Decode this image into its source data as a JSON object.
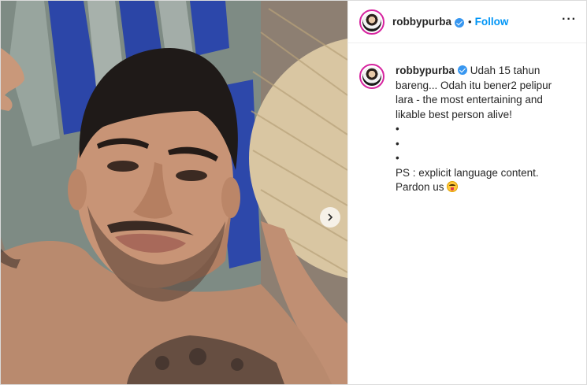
{
  "post": {
    "author": {
      "username": "robbypurba",
      "verified": true
    },
    "header": {
      "separator": "•",
      "follow_label": "Follow",
      "more_label": "···"
    },
    "caption": {
      "lines": [
        "Udah 15 tahun bareng... Odah itu bener2 pelipur lara - the most entertaining and likable best person alive!",
        "•",
        "•",
        "•",
        "PS : explicit language content. Pardon us"
      ],
      "emoji": "face-with-tongue-emoji"
    },
    "media": {
      "carousel_next_icon": "chevron-right-icon"
    }
  },
  "colors": {
    "link_blue": "#0095f6",
    "verified_blue": "#3897f0",
    "text": "#262626",
    "story_ring": "#d6249f"
  }
}
